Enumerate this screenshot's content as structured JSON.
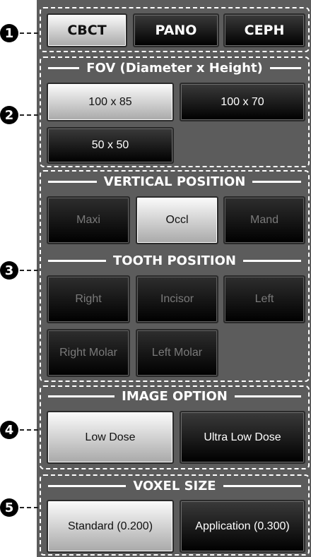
{
  "callouts": [
    "1",
    "2",
    "3",
    "4",
    "5"
  ],
  "mode_tabs": [
    {
      "label": "CBCT",
      "state": "selected"
    },
    {
      "label": "PANO",
      "state": "enabled"
    },
    {
      "label": "CEPH",
      "state": "enabled"
    }
  ],
  "fov": {
    "title": "FOV (Diameter x Height)",
    "options": [
      {
        "label": "100 x 85",
        "state": "selected"
      },
      {
        "label": "100 x 70",
        "state": "enabled"
      },
      {
        "label": "50 x 50",
        "state": "enabled"
      }
    ]
  },
  "vertical_position": {
    "title": "VERTICAL POSITION",
    "options": [
      {
        "label": "Maxi",
        "state": "disabled"
      },
      {
        "label": "Occl",
        "state": "selected"
      },
      {
        "label": "Mand",
        "state": "disabled"
      }
    ]
  },
  "tooth_position": {
    "title": "TOOTH POSITION",
    "options": [
      {
        "label": "Right",
        "state": "disabled"
      },
      {
        "label": "Incisor",
        "state": "disabled"
      },
      {
        "label": "Left",
        "state": "disabled"
      },
      {
        "label": "Right Molar",
        "state": "disabled"
      },
      {
        "label": "Left Molar",
        "state": "disabled"
      }
    ]
  },
  "image_option": {
    "title": "IMAGE OPTION",
    "options": [
      {
        "label": "Low Dose",
        "state": "selected"
      },
      {
        "label": "Ultra Low Dose",
        "state": "enabled"
      }
    ]
  },
  "voxel_size": {
    "title": "VOXEL SIZE",
    "options": [
      {
        "label": "Standard (0.200)",
        "state": "selected"
      },
      {
        "label": "Application (0.300)",
        "state": "enabled"
      }
    ]
  },
  "colors": {
    "panel": "#5c5c5c",
    "selected_button": "#d9d9d9",
    "enabled_button": "#000000",
    "disabled_text": "#7a7a7a",
    "dashed_border": "#ffffff"
  }
}
